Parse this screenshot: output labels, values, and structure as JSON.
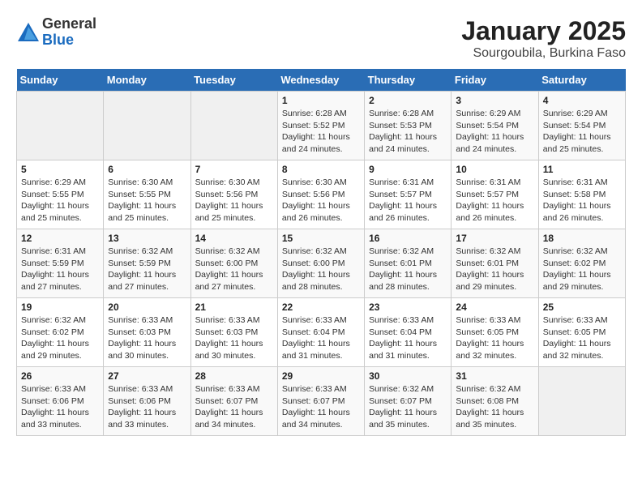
{
  "logo": {
    "general": "General",
    "blue": "Blue"
  },
  "title": "January 2025",
  "subtitle": "Sourgoubila, Burkina Faso",
  "days_of_week": [
    "Sunday",
    "Monday",
    "Tuesday",
    "Wednesday",
    "Thursday",
    "Friday",
    "Saturday"
  ],
  "weeks": [
    [
      {
        "day": "",
        "info": ""
      },
      {
        "day": "",
        "info": ""
      },
      {
        "day": "",
        "info": ""
      },
      {
        "day": "1",
        "info": "Sunrise: 6:28 AM\nSunset: 5:52 PM\nDaylight: 11 hours and 24 minutes."
      },
      {
        "day": "2",
        "info": "Sunrise: 6:28 AM\nSunset: 5:53 PM\nDaylight: 11 hours and 24 minutes."
      },
      {
        "day": "3",
        "info": "Sunrise: 6:29 AM\nSunset: 5:54 PM\nDaylight: 11 hours and 24 minutes."
      },
      {
        "day": "4",
        "info": "Sunrise: 6:29 AM\nSunset: 5:54 PM\nDaylight: 11 hours and 25 minutes."
      }
    ],
    [
      {
        "day": "5",
        "info": "Sunrise: 6:29 AM\nSunset: 5:55 PM\nDaylight: 11 hours and 25 minutes."
      },
      {
        "day": "6",
        "info": "Sunrise: 6:30 AM\nSunset: 5:55 PM\nDaylight: 11 hours and 25 minutes."
      },
      {
        "day": "7",
        "info": "Sunrise: 6:30 AM\nSunset: 5:56 PM\nDaylight: 11 hours and 25 minutes."
      },
      {
        "day": "8",
        "info": "Sunrise: 6:30 AM\nSunset: 5:56 PM\nDaylight: 11 hours and 26 minutes."
      },
      {
        "day": "9",
        "info": "Sunrise: 6:31 AM\nSunset: 5:57 PM\nDaylight: 11 hours and 26 minutes."
      },
      {
        "day": "10",
        "info": "Sunrise: 6:31 AM\nSunset: 5:57 PM\nDaylight: 11 hours and 26 minutes."
      },
      {
        "day": "11",
        "info": "Sunrise: 6:31 AM\nSunset: 5:58 PM\nDaylight: 11 hours and 26 minutes."
      }
    ],
    [
      {
        "day": "12",
        "info": "Sunrise: 6:31 AM\nSunset: 5:59 PM\nDaylight: 11 hours and 27 minutes."
      },
      {
        "day": "13",
        "info": "Sunrise: 6:32 AM\nSunset: 5:59 PM\nDaylight: 11 hours and 27 minutes."
      },
      {
        "day": "14",
        "info": "Sunrise: 6:32 AM\nSunset: 6:00 PM\nDaylight: 11 hours and 27 minutes."
      },
      {
        "day": "15",
        "info": "Sunrise: 6:32 AM\nSunset: 6:00 PM\nDaylight: 11 hours and 28 minutes."
      },
      {
        "day": "16",
        "info": "Sunrise: 6:32 AM\nSunset: 6:01 PM\nDaylight: 11 hours and 28 minutes."
      },
      {
        "day": "17",
        "info": "Sunrise: 6:32 AM\nSunset: 6:01 PM\nDaylight: 11 hours and 29 minutes."
      },
      {
        "day": "18",
        "info": "Sunrise: 6:32 AM\nSunset: 6:02 PM\nDaylight: 11 hours and 29 minutes."
      }
    ],
    [
      {
        "day": "19",
        "info": "Sunrise: 6:32 AM\nSunset: 6:02 PM\nDaylight: 11 hours and 29 minutes."
      },
      {
        "day": "20",
        "info": "Sunrise: 6:33 AM\nSunset: 6:03 PM\nDaylight: 11 hours and 30 minutes."
      },
      {
        "day": "21",
        "info": "Sunrise: 6:33 AM\nSunset: 6:03 PM\nDaylight: 11 hours and 30 minutes."
      },
      {
        "day": "22",
        "info": "Sunrise: 6:33 AM\nSunset: 6:04 PM\nDaylight: 11 hours and 31 minutes."
      },
      {
        "day": "23",
        "info": "Sunrise: 6:33 AM\nSunset: 6:04 PM\nDaylight: 11 hours and 31 minutes."
      },
      {
        "day": "24",
        "info": "Sunrise: 6:33 AM\nSunset: 6:05 PM\nDaylight: 11 hours and 32 minutes."
      },
      {
        "day": "25",
        "info": "Sunrise: 6:33 AM\nSunset: 6:05 PM\nDaylight: 11 hours and 32 minutes."
      }
    ],
    [
      {
        "day": "26",
        "info": "Sunrise: 6:33 AM\nSunset: 6:06 PM\nDaylight: 11 hours and 33 minutes."
      },
      {
        "day": "27",
        "info": "Sunrise: 6:33 AM\nSunset: 6:06 PM\nDaylight: 11 hours and 33 minutes."
      },
      {
        "day": "28",
        "info": "Sunrise: 6:33 AM\nSunset: 6:07 PM\nDaylight: 11 hours and 34 minutes."
      },
      {
        "day": "29",
        "info": "Sunrise: 6:33 AM\nSunset: 6:07 PM\nDaylight: 11 hours and 34 minutes."
      },
      {
        "day": "30",
        "info": "Sunrise: 6:32 AM\nSunset: 6:07 PM\nDaylight: 11 hours and 35 minutes."
      },
      {
        "day": "31",
        "info": "Sunrise: 6:32 AM\nSunset: 6:08 PM\nDaylight: 11 hours and 35 minutes."
      },
      {
        "day": "",
        "info": ""
      }
    ]
  ]
}
